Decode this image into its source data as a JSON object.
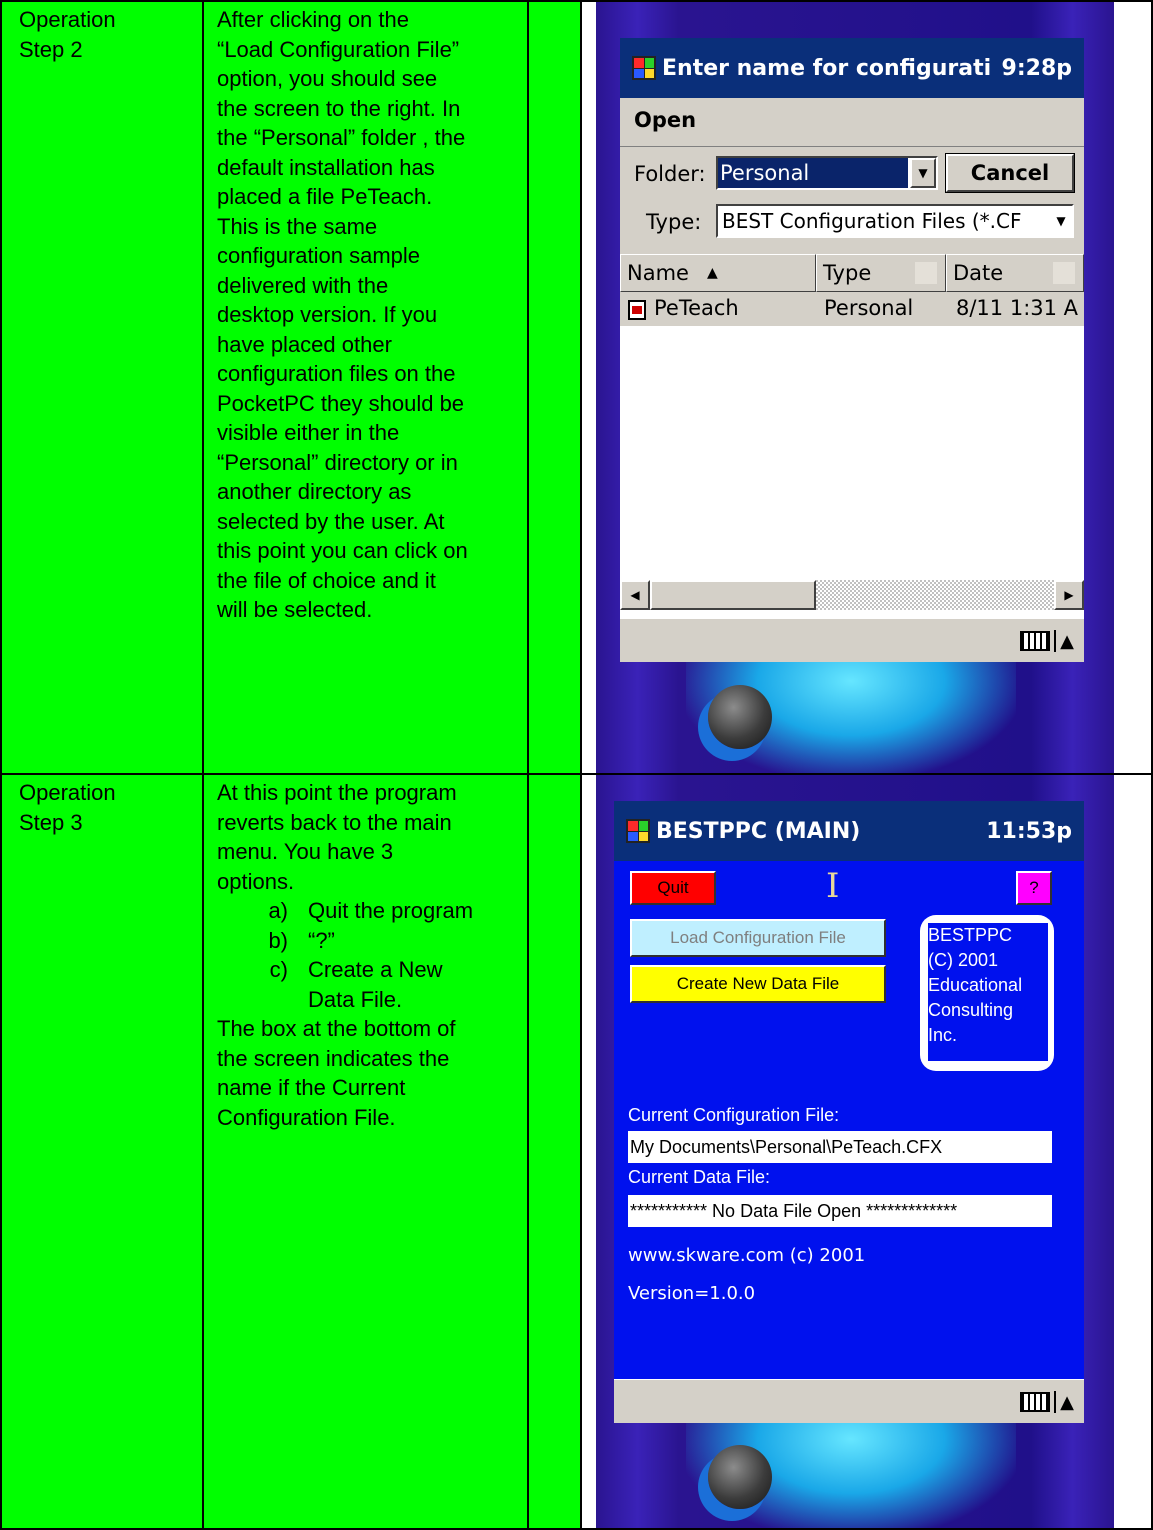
{
  "rows": [
    {
      "step": [
        "Operation",
        "Step 2"
      ],
      "description": [
        "After clicking on the",
        "“Load Configuration File”",
        "option, you should see",
        "the screen to the right. In",
        "the “Personal” folder , the",
        "default installation has",
        "placed a file PeTeach.",
        "This is the same",
        "configuration sample",
        "delivered with the",
        "desktop version. If you",
        "have placed other",
        "configuration files on the",
        "PocketPC they should be",
        "visible either in the",
        "“Personal” directory or in",
        "another directory as",
        "selected by the user. At",
        "this point you can click on",
        "the file of choice and it",
        "will be selected."
      ]
    },
    {
      "step": [
        "Operation",
        "Step 3"
      ],
      "intro": [
        "At this point the program",
        "reverts back to the main",
        "menu. You have 3",
        "options."
      ],
      "options": [
        {
          "label": "a)",
          "text": [
            "Quit the program"
          ]
        },
        {
          "label": "b)",
          "text": [
            "“?”"
          ]
        },
        {
          "label": "c)",
          "text": [
            "Create a New",
            "Data File."
          ]
        }
      ],
      "outro": [
        "The box at the bottom of",
        "the screen  indicates the",
        "name if the Current",
        "Configuration File."
      ]
    }
  ],
  "dialog_screen": {
    "title": "Enter name for configurati",
    "time": "9:28p",
    "open_label": "Open",
    "folder_label": "Folder:",
    "folder_value": "Personal",
    "cancel_label": "Cancel",
    "type_label": "Type:",
    "type_value": "BEST Configuration Files  (*.CF",
    "columns": [
      "Name",
      "Type",
      "Date"
    ],
    "files": [
      {
        "name": "PeTeach",
        "type": "Personal",
        "date": "8/11 1:31 A"
      }
    ]
  },
  "main_screen": {
    "title": "BESTPPC (MAIN)",
    "time": "11:53p",
    "quit_label": "Quit",
    "help_label": "?",
    "load_label": "Load Configuration File",
    "create_label": "Create New Data File",
    "about_lines": [
      "BESTPPC",
      "(C) 2001",
      "Educational",
      "Consulting",
      "Inc."
    ],
    "config_label": "Current Configuration File:",
    "config_value": "My Documents\\Personal\\PeTeach.CFX",
    "data_label": "Current Data File:",
    "data_value": "*********** No Data File Open *************",
    "website": "www.skware.com (c) 2001",
    "version": "Version=1.0.0"
  },
  "colors": {
    "cell_green": "#00ff00",
    "screen_blue": "#0011ee",
    "titlebar": "#0a2f7a",
    "quit_red": "#ff0000",
    "help_magenta": "#ff00ff",
    "load_cyan": "#bfefff",
    "create_yellow": "#ffff00"
  }
}
